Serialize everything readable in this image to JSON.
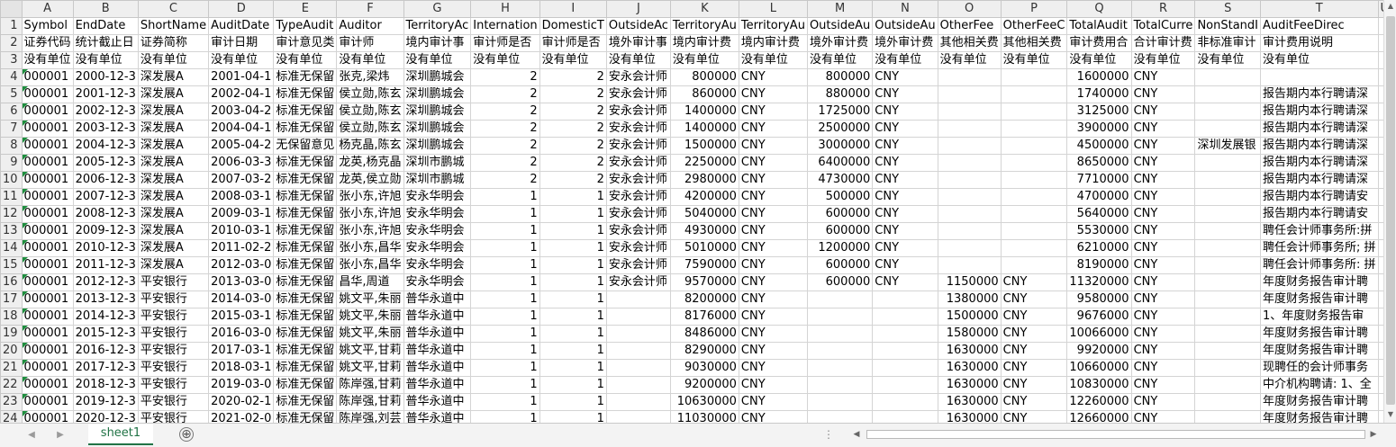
{
  "columns": [
    "A",
    "B",
    "C",
    "D",
    "E",
    "F",
    "G",
    "H",
    "I",
    "J",
    "K",
    "L",
    "M",
    "N",
    "O",
    "P",
    "Q",
    "R",
    "S",
    "T",
    "U"
  ],
  "rows": [
    {
      "n": "1",
      "c": [
        "Symbol",
        "EndDate",
        "ShortName",
        "AuditDate",
        "TypeAudit",
        "Auditor",
        "TerritoryAc",
        "Internation",
        "DomesticT",
        "OutsideAc",
        "TerritoryAu",
        "TerritoryAu",
        "OutsideAu",
        "OutsideAu",
        "OtherFee",
        "OtherFeeC",
        "TotalAudit",
        "TotalCurre",
        "NonStandI",
        "AuditFeeDirec",
        ""
      ]
    },
    {
      "n": "2",
      "c": [
        "证券代码",
        "统计截止日",
        "证券简称",
        "审计日期",
        "审计意见类",
        "审计师",
        "境内审计事",
        "审计师是否",
        "审计师是否",
        "境外审计事",
        "境内审计费",
        "境内审计费",
        "境外审计费",
        "境外审计费",
        "其他相关费",
        "其他相关费",
        "审计费用合",
        "合计审计费",
        "非标准审计",
        "审计费用说明",
        ""
      ]
    },
    {
      "n": "3",
      "c": [
        "没有单位",
        "没有单位",
        "没有单位",
        "没有单位",
        "没有单位",
        "没有单位",
        "没有单位",
        "没有单位",
        "没有单位",
        "没有单位",
        "没有单位",
        "没有单位",
        "没有单位",
        "没有单位",
        "没有单位",
        "没有单位",
        "没有单位",
        "没有单位",
        "没有单位",
        "没有单位",
        ""
      ]
    },
    {
      "n": "4",
      "c": [
        "000001",
        "2000-12-3",
        "深发展A",
        "2001-04-1",
        "标准无保留",
        "张克,梁炜",
        "深圳鹏城会",
        "2",
        "2",
        "安永会计师",
        "800000",
        "CNY",
        "800000",
        "CNY",
        "",
        "",
        "1600000",
        "CNY",
        "",
        "",
        ""
      ]
    },
    {
      "n": "5",
      "c": [
        "000001",
        "2001-12-3",
        "深发展A",
        "2002-04-1",
        "标准无保留",
        "侯立勋,陈玄",
        "深圳鹏城会",
        "2",
        "2",
        "安永会计师",
        "860000",
        "CNY",
        "880000",
        "CNY",
        "",
        "",
        "1740000",
        "CNY",
        "",
        "报告期内本行聘请深",
        ""
      ]
    },
    {
      "n": "6",
      "c": [
        "000001",
        "2002-12-3",
        "深发展A",
        "2003-04-2",
        "标准无保留",
        "侯立勋,陈玄",
        "深圳鹏城会",
        "2",
        "2",
        "安永会计师",
        "1400000",
        "CNY",
        "1725000",
        "CNY",
        "",
        "",
        "3125000",
        "CNY",
        "",
        "报告期内本行聘请深",
        ""
      ]
    },
    {
      "n": "7",
      "c": [
        "000001",
        "2003-12-3",
        "深发展A",
        "2004-04-1",
        "标准无保留",
        "侯立勋,陈玄",
        "深圳鹏城会",
        "2",
        "2",
        "安永会计师",
        "1400000",
        "CNY",
        "2500000",
        "CNY",
        "",
        "",
        "3900000",
        "CNY",
        "",
        "报告期内本行聘请深",
        ""
      ]
    },
    {
      "n": "8",
      "c": [
        "000001",
        "2004-12-3",
        "深发展A",
        "2005-04-2",
        "无保留意见",
        "杨克晶,陈玄",
        "深圳鹏城会",
        "2",
        "2",
        "安永会计师",
        "1500000",
        "CNY",
        "3000000",
        "CNY",
        "",
        "",
        "4500000",
        "CNY",
        "深圳发展银",
        "报告期内本行聘请深",
        ""
      ]
    },
    {
      "n": "9",
      "c": [
        "000001",
        "2005-12-3",
        "深发展A",
        "2006-03-3",
        "标准无保留",
        "龙英,杨克晶",
        "深圳市鹏城",
        "2",
        "2",
        "安永会计师",
        "2250000",
        "CNY",
        "6400000",
        "CNY",
        "",
        "",
        "8650000",
        "CNY",
        "",
        "报告期内本行聘请深",
        ""
      ]
    },
    {
      "n": "10",
      "c": [
        "000001",
        "2006-12-3",
        "深发展A",
        "2007-03-2",
        "标准无保留",
        "龙英,侯立勋",
        "深圳市鹏城",
        "2",
        "2",
        "安永会计师",
        "2980000",
        "CNY",
        "4730000",
        "CNY",
        "",
        "",
        "7710000",
        "CNY",
        "",
        "报告期内本行聘请深",
        ""
      ]
    },
    {
      "n": "11",
      "c": [
        "000001",
        "2007-12-3",
        "深发展A",
        "2008-03-1",
        "标准无保留",
        "张小东,许旭",
        "安永华明会",
        "1",
        "1",
        "安永会计师",
        "4200000",
        "CNY",
        "500000",
        "CNY",
        "",
        "",
        "4700000",
        "CNY",
        "",
        "报告期内本行聘请安",
        ""
      ]
    },
    {
      "n": "12",
      "c": [
        "000001",
        "2008-12-3",
        "深发展A",
        "2009-03-1",
        "标准无保留",
        "张小东,许旭",
        "安永华明会",
        "1",
        "1",
        "安永会计师",
        "5040000",
        "CNY",
        "600000",
        "CNY",
        "",
        "",
        "5640000",
        "CNY",
        "",
        "报告期内本行聘请安",
        ""
      ]
    },
    {
      "n": "13",
      "c": [
        "000001",
        "2009-12-3",
        "深发展A",
        "2010-03-1",
        "标准无保留",
        "张小东,许旭",
        "安永华明会",
        "1",
        "1",
        "安永会计师",
        "4930000",
        "CNY",
        "600000",
        "CNY",
        "",
        "",
        "5530000",
        "CNY",
        "",
        "聘任会计师事务所:拼",
        ""
      ]
    },
    {
      "n": "14",
      "c": [
        "000001",
        "2010-12-3",
        "深发展A",
        "2011-02-2",
        "标准无保留",
        "张小东,昌华",
        "安永华明会",
        "1",
        "1",
        "安永会计师",
        "5010000",
        "CNY",
        "1200000",
        "CNY",
        "",
        "",
        "6210000",
        "CNY",
        "",
        "聘任会计师事务所; 拼",
        ""
      ]
    },
    {
      "n": "15",
      "c": [
        "000001",
        "2011-12-3",
        "深发展A",
        "2012-03-0",
        "标准无保留",
        "张小东,昌华",
        "安永华明会",
        "1",
        "1",
        "安永会计师",
        "7590000",
        "CNY",
        "600000",
        "CNY",
        "",
        "",
        "8190000",
        "CNY",
        "",
        "聘任会计师事务所: 拼",
        ""
      ]
    },
    {
      "n": "16",
      "c": [
        "000001",
        "2012-12-3",
        "平安银行",
        "2013-03-0",
        "标准无保留",
        "昌华,周道",
        "安永华明会",
        "1",
        "1",
        "安永会计师",
        "9570000",
        "CNY",
        "600000",
        "CNY",
        "1150000",
        "CNY",
        "11320000",
        "CNY",
        "",
        "年度财务报告审计聘",
        ""
      ]
    },
    {
      "n": "17",
      "c": [
        "000001",
        "2013-12-3",
        "平安银行",
        "2014-03-0",
        "标准无保留",
        "姚文平,朱丽",
        "普华永道中",
        "1",
        "1",
        "",
        "8200000",
        "CNY",
        "",
        "",
        "1380000",
        "CNY",
        "9580000",
        "CNY",
        "",
        "年度财务报告审计聘",
        ""
      ]
    },
    {
      "n": "18",
      "c": [
        "000001",
        "2014-12-3",
        "平安银行",
        "2015-03-1",
        "标准无保留",
        "姚文平,朱丽",
        "普华永道中",
        "1",
        "1",
        "",
        "8176000",
        "CNY",
        "",
        "",
        "1500000",
        "CNY",
        "9676000",
        "CNY",
        "",
        "1、年度财务报告审",
        ""
      ]
    },
    {
      "n": "19",
      "c": [
        "000001",
        "2015-12-3",
        "平安银行",
        "2016-03-0",
        "标准无保留",
        "姚文平,朱丽",
        "普华永道中",
        "1",
        "1",
        "",
        "8486000",
        "CNY",
        "",
        "",
        "1580000",
        "CNY",
        "10066000",
        "CNY",
        "",
        "年度财务报告审计聘",
        ""
      ]
    },
    {
      "n": "20",
      "c": [
        "000001",
        "2016-12-3",
        "平安银行",
        "2017-03-1",
        "标准无保留",
        "姚文平,甘莉",
        "普华永道中",
        "1",
        "1",
        "",
        "8290000",
        "CNY",
        "",
        "",
        "1630000",
        "CNY",
        "9920000",
        "CNY",
        "",
        "年度财务报告审计聘",
        ""
      ]
    },
    {
      "n": "21",
      "c": [
        "000001",
        "2017-12-3",
        "平安银行",
        "2018-03-1",
        "标准无保留",
        "姚文平,甘莉",
        "普华永道中",
        "1",
        "1",
        "",
        "9030000",
        "CNY",
        "",
        "",
        "1630000",
        "CNY",
        "10660000",
        "CNY",
        "",
        "现聘任的会计师事务",
        ""
      ]
    },
    {
      "n": "22",
      "c": [
        "000001",
        "2018-12-3",
        "平安银行",
        "2019-03-0",
        "标准无保留",
        "陈岸强,甘莉",
        "普华永道中",
        "1",
        "1",
        "",
        "9200000",
        "CNY",
        "",
        "",
        "1630000",
        "CNY",
        "10830000",
        "CNY",
        "",
        "中介机构聘请: 1、全",
        ""
      ]
    },
    {
      "n": "23",
      "c": [
        "000001",
        "2019-12-3",
        "平安银行",
        "2020-02-1",
        "标准无保留",
        "陈岸强,甘莉",
        "普华永道中",
        "1",
        "1",
        "",
        "10630000",
        "CNY",
        "",
        "",
        "1630000",
        "CNY",
        "12260000",
        "CNY",
        "",
        "年度财务报告审计聘",
        ""
      ]
    },
    {
      "n": "24",
      "c": [
        "000001",
        "2020-12-3",
        "平安银行",
        "2021-02-0",
        "标准无保留",
        "陈岸强,刘芸",
        "普华永道中",
        "1",
        "1",
        "",
        "11030000",
        "CNY",
        "",
        "",
        "1630000",
        "CNY",
        "12660000",
        "CNY",
        "",
        "年度财务报告审计聘",
        ""
      ]
    }
  ],
  "sheet_tab": "sheet1",
  "add_sheet_symbol": "⊕",
  "tab_separator": "⋮",
  "colors": {
    "accent": "#217346",
    "flag": "#1e8e3e",
    "header_bg": "#efefef",
    "grid": "#d4d4d4"
  }
}
